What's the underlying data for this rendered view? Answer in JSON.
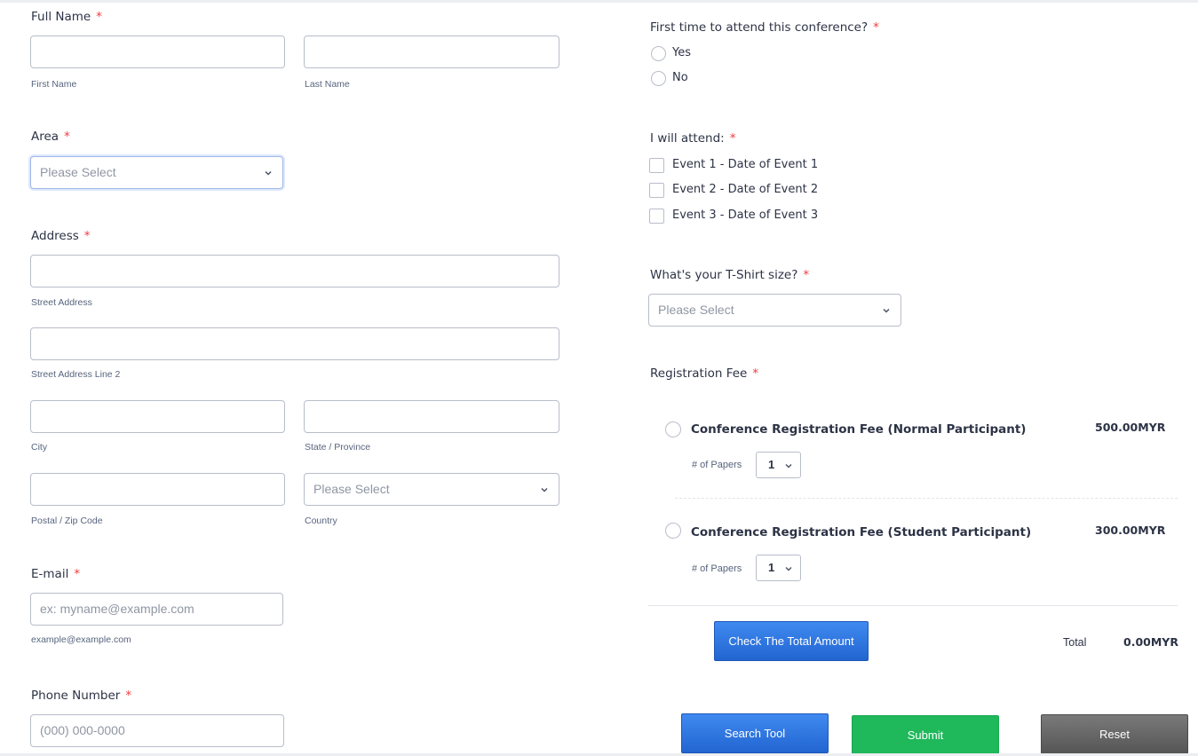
{
  "form": {
    "full_name": {
      "label": "Full Name",
      "required_mark": "*",
      "first_sublabel": "First Name",
      "last_sublabel": "Last Name",
      "first_value": "",
      "last_value": ""
    },
    "area": {
      "label": "Area",
      "required_mark": "*",
      "selected": "Please Select"
    },
    "address": {
      "label": "Address",
      "required_mark": "*",
      "street_sublabel": "Street Address",
      "street2_sublabel": "Street Address Line 2",
      "city_sublabel": "City",
      "state_sublabel": "State / Province",
      "postal_sublabel": "Postal / Zip Code",
      "country_sublabel": "Country",
      "country_selected": "Please Select"
    },
    "email": {
      "label": "E-mail",
      "required_mark": "*",
      "placeholder": "ex: myname@example.com",
      "sublabel": "example@example.com"
    },
    "phone": {
      "label": "Phone Number",
      "required_mark": "*",
      "placeholder": "(000) 000-0000"
    },
    "first_time": {
      "label": "First time to attend this conference?",
      "required_mark": "*",
      "options": [
        "Yes",
        "No"
      ]
    },
    "attend": {
      "label": "I will attend:",
      "required_mark": "*",
      "options": [
        "Event 1 - Date of Event 1",
        "Event 2 - Date of Event 2",
        "Event 3 - Date of Event 3"
      ]
    },
    "tshirt": {
      "label": "What's your T-Shirt size?",
      "required_mark": "*",
      "selected": "Please Select"
    },
    "registration_fee": {
      "label": "Registration Fee",
      "required_mark": "*",
      "products": [
        {
          "name": "Conference Registration Fee (Normal Participant)",
          "price": "500.00",
          "currency": "MYR",
          "qty_label": "# of Papers",
          "qty": "1"
        },
        {
          "name": "Conference Registration Fee (Student Participant)",
          "price": "300.00",
          "currency": "MYR",
          "qty_label": "# of Papers",
          "qty": "1"
        }
      ],
      "check_button": "Check The Total Amount",
      "total_label": "Total",
      "total_value": "0.00",
      "total_currency": "MYR"
    }
  },
  "buttons": {
    "search_tool": "Search Tool",
    "submit": "Submit",
    "reset": "Reset"
  },
  "colors": {
    "required": "#f23a3c",
    "primary_blue": "#2a6fe0",
    "submit_green": "#1fb85b",
    "reset_gray": "#666666"
  }
}
